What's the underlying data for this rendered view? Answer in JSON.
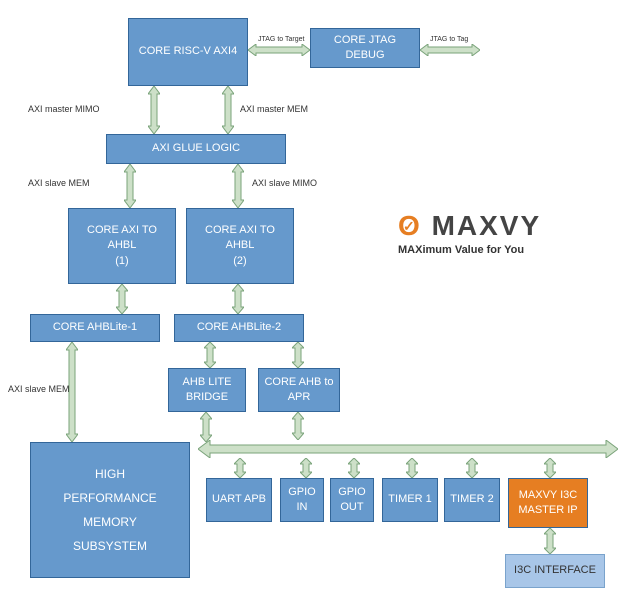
{
  "blocks": {
    "riscv": "CORE RISC-V AXI4",
    "jtag": "CORE JTAG DEBUG",
    "glue": "AXI GLUE LOGIC",
    "axi_ahbl1": "CORE AXI TO AHBL\n(1)",
    "axi_ahbl2": "CORE AXI TO AHBL\n(2)",
    "ahblite1": "CORE AHBLite-1",
    "ahblite2": "CORE AHBLite-2",
    "ahb_bridge": "AHB LITE BRIDGE",
    "ahb_apr": "CORE AHB to APR",
    "mem_sub": "HIGH\nPERFORMANCE\nMEMORY\nSUBSYSTEM",
    "uart": "UART APB",
    "gpio_in": "GPIO IN",
    "gpio_out": "GPIO OUT",
    "timer1": "TIMER 1",
    "timer2": "TIMER 2",
    "i3c_master": "MAXVY I3C MASTER IP",
    "i3c_if": "I3C INTERFACE"
  },
  "labels": {
    "axi_master_mimo": "AXI master MIMO",
    "axi_master_mem": "AXI master MEM",
    "axi_slave_mem_top": "AXI slave MEM",
    "axi_slave_mimo": "AXI slave MIMO",
    "axi_slave_mem_left": "AXI slave MEM",
    "jtag_target": "JTAG to Target",
    "jtag_tag": "JTAG to Tag"
  },
  "logo": {
    "brand_o": "O",
    "brand_rest": "MAXVY",
    "tagline": "MAXimum Value for You"
  }
}
